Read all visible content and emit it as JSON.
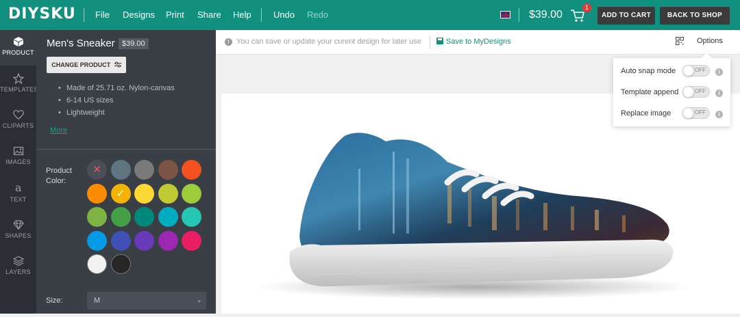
{
  "header": {
    "logo": "DIYSKU",
    "menu": [
      "File",
      "Designs",
      "Print",
      "Share",
      "Help"
    ],
    "undo": "Undo",
    "redo": "Redo",
    "price": "$39.00",
    "cart_count": "1",
    "add_to_cart": "ADD TO CART",
    "back_to_shop": "BACK TO SHOP",
    "flag_icon": "uk-flag-icon",
    "brand_color": "#11907f"
  },
  "rail": [
    {
      "label": "PRODUCT",
      "icon": "box-icon",
      "active": true
    },
    {
      "label": "TEMPLATES",
      "icon": "star-icon",
      "active": false
    },
    {
      "label": "CLIPARTS",
      "icon": "heart-icon",
      "active": false
    },
    {
      "label": "IMAGES",
      "icon": "image-icon",
      "active": false
    },
    {
      "label": "TEXT",
      "icon": "text-icon",
      "active": false
    },
    {
      "label": "SHAPES",
      "icon": "diamond-icon",
      "active": false
    },
    {
      "label": "LAYERS",
      "icon": "layers-icon",
      "active": false
    }
  ],
  "product": {
    "name": "Men's Sneaker",
    "price": "$39.00",
    "change_button": "CHANGE PRODUCT",
    "features": [
      "Made of 25.71 oz. Nylon-canvas",
      "6-14 US sizes",
      "Lightweight"
    ],
    "more": "More",
    "color_label": "Product Color:",
    "colors": [
      {
        "hex": "#4a4f57",
        "mark": "✕",
        "mark_color": "#e05a6a"
      },
      {
        "hex": "#5f7682",
        "mark": "",
        "mark_color": ""
      },
      {
        "hex": "#7a7a7a",
        "mark": "",
        "mark_color": ""
      },
      {
        "hex": "#7b5446",
        "mark": "",
        "mark_color": ""
      },
      {
        "hex": "#f4511e",
        "mark": "",
        "mark_color": ""
      },
      {
        "hex": "#fb8c00",
        "mark": "",
        "mark_color": ""
      },
      {
        "hex": "#f5b300",
        "mark": "✓",
        "mark_color": "#ffffff"
      },
      {
        "hex": "#fdd835",
        "mark": "",
        "mark_color": ""
      },
      {
        "hex": "#c0ca33",
        "mark": "",
        "mark_color": ""
      },
      {
        "hex": "#9ccc3c",
        "mark": "",
        "mark_color": ""
      },
      {
        "hex": "#7cb342",
        "mark": "",
        "mark_color": ""
      },
      {
        "hex": "#43a047",
        "mark": "",
        "mark_color": ""
      },
      {
        "hex": "#00897b",
        "mark": "",
        "mark_color": ""
      },
      {
        "hex": "#00acc1",
        "mark": "",
        "mark_color": ""
      },
      {
        "hex": "#26c6b5",
        "mark": "",
        "mark_color": ""
      },
      {
        "hex": "#039be5",
        "mark": "",
        "mark_color": ""
      },
      {
        "hex": "#3f51b5",
        "mark": "",
        "mark_color": ""
      },
      {
        "hex": "#673ab7",
        "mark": "",
        "mark_color": ""
      },
      {
        "hex": "#9c27b0",
        "mark": "",
        "mark_color": ""
      },
      {
        "hex": "#e91e63",
        "mark": "",
        "mark_color": ""
      },
      {
        "hex": "#f2f2f2",
        "mark": "",
        "mark_color": ""
      },
      {
        "hex": "#262626",
        "mark": "",
        "mark_color": ""
      }
    ],
    "size_label": "Size:",
    "size_value": "M"
  },
  "infobar": {
    "message": "You can save or update your curent design for later use",
    "save_link": "Save to MyDesigns",
    "options": "Options"
  },
  "options_menu": [
    {
      "label": "Auto snap mode",
      "state": "OFF"
    },
    {
      "label": "Template append",
      "state": "OFF"
    },
    {
      "label": "Replace image",
      "state": "OFF"
    }
  ]
}
